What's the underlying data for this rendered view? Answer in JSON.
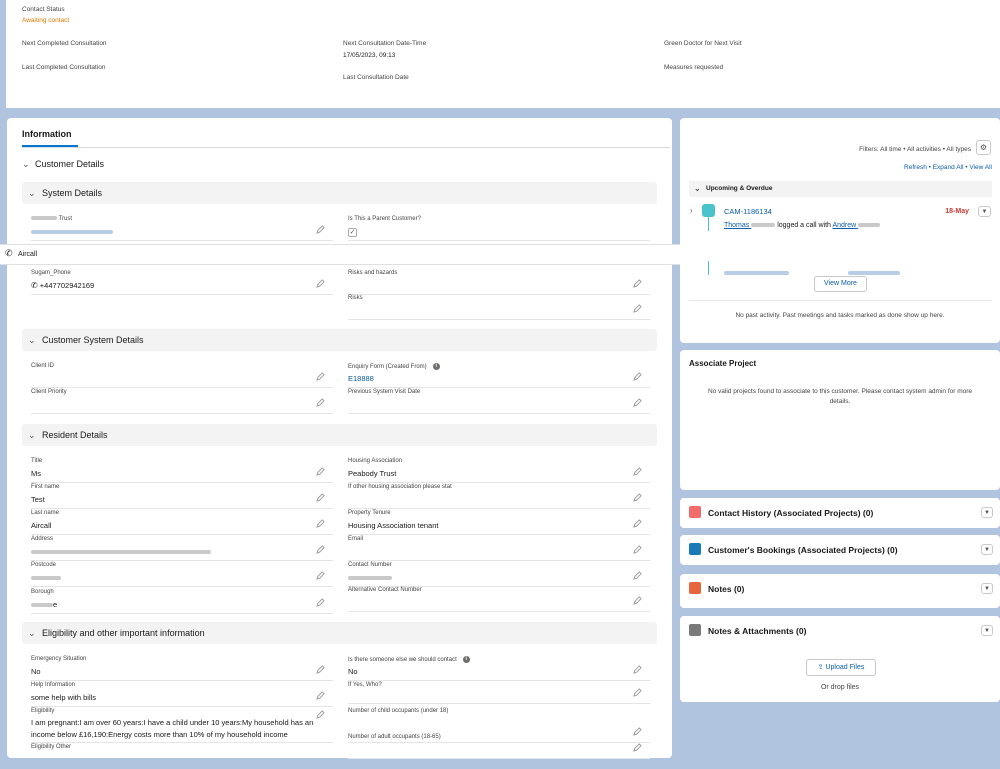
{
  "top": {
    "contact_status_label": "Contact Status",
    "contact_status_value": "Awaiting contact",
    "next_completed_label": "Next Completed Consultation",
    "last_completed_label": "Last Completed Consultation",
    "next_consult_dt_label": "Next Consultation Date-Time",
    "next_consult_dt_value": "17/05/2023, 09:13",
    "last_consult_date_label": "Last Consultation Date",
    "green_doctor_label": "Green Doctor for Next Visit",
    "measures_label": "Measures requested"
  },
  "tabs": {
    "information": "Information"
  },
  "sections": {
    "customer_details": "Customer Details",
    "system_details": "System Details",
    "customer_system_details": "Customer System Details",
    "resident_details": "Resident Details",
    "eligibility": "Eligibility and other important information"
  },
  "system_details": {
    "trust_label": "Trust",
    "parent_label": "Is This a Parent Customer?",
    "sugam_phone_label": "Sugam_Phone",
    "sugam_phone_value": "+447702942169",
    "risks_hazards_label": "Risks and hazards",
    "risks_label": "Risks"
  },
  "customer_system": {
    "client_id_label": "Client ID",
    "client_priority_label": "Client Priority",
    "enquiry_label": "Enquiry Form (Created From)",
    "enquiry_value": "E18888",
    "prev_visit_label": "Previous System Visit Date"
  },
  "resident": {
    "title_label": "Title",
    "title_value": "Ms",
    "first_label": "First name",
    "first_value": "Test",
    "last_label": "Last name",
    "last_value": "Aircall",
    "address_label": "Address",
    "postcode_label": "Postcode",
    "borough_label": "Borough",
    "borough_value_end": "e",
    "housing_label": "Housing Association",
    "housing_value": "Peabody Trust",
    "other_housing_label": "If other housing association please stat",
    "tenure_label": "Property Tenure",
    "tenure_value": "Housing Association tenant",
    "email_label": "Email",
    "contact_label": "Contact Number",
    "alt_contact_label": "Alternative Contact Number"
  },
  "eligibility": {
    "emergency_label": "Emergency Situation",
    "emergency_value": "No",
    "help_label": "Help Information",
    "help_value": "some help with bills",
    "elig_label": "Eligibility",
    "elig_value_1": "I am pregnant:I am over 60 years:I have a child under 10 years:My household has an",
    "elig_value_2": "income below £16,190:Energy costs more than 10% of my household income",
    "elig_other_label": "Eligibility Other",
    "someone_label": "Is there someone else we should contact",
    "someone_value": "No",
    "ifyes_label": "If Yes, Who?",
    "child_occ_label": "Number of child occupants (under 18)",
    "adult_occ_label": "Number of adult occupants (18-65)"
  },
  "aircall": {
    "label": "Aircall"
  },
  "activity": {
    "filters": "Filters: All time • All activities • All types",
    "refresh": "Refresh",
    "expand_all": "Expand All",
    "view_all": "View All",
    "sep": "•",
    "upcoming_label": "Upcoming & Overdue",
    "item_title": "CAM-1186134",
    "item_date": "18-May",
    "item_actor": "Thomas",
    "item_text": "logged a call with",
    "item_target": "Andrew",
    "view_more": "View More",
    "no_past": "No past activity. Past meetings and tasks marked as done show up here."
  },
  "associate": {
    "title": "Associate Project",
    "message": "No valid projects found to associate to this customer. Please contact system admin for more details."
  },
  "related": {
    "contact_history": "Contact History (Associated Projects) (0)",
    "bookings": "Customer's Bookings (Associated Projects) (0)",
    "notes": "Notes (0)",
    "attachments": "Notes & Attachments (0)",
    "upload": "Upload Files",
    "drop": "Or drop files"
  },
  "colors": {
    "status_orange": "#dd7a01",
    "link_blue": "#0b5cab",
    "brand_blue": "#0176d3",
    "date_red": "#c23934",
    "contact_history_icon": "#f16b6b",
    "bookings_icon": "#1a7ab8",
    "notes_icon": "#e8663e",
    "attachments_icon": "#7a7a7a"
  },
  "icons": [
    "chevron-down-icon",
    "chevron-right-icon",
    "pencil-icon",
    "phone-icon",
    "info-icon",
    "gear-icon",
    "upload-icon",
    "dropdown-icon",
    "call-log-icon"
  ]
}
